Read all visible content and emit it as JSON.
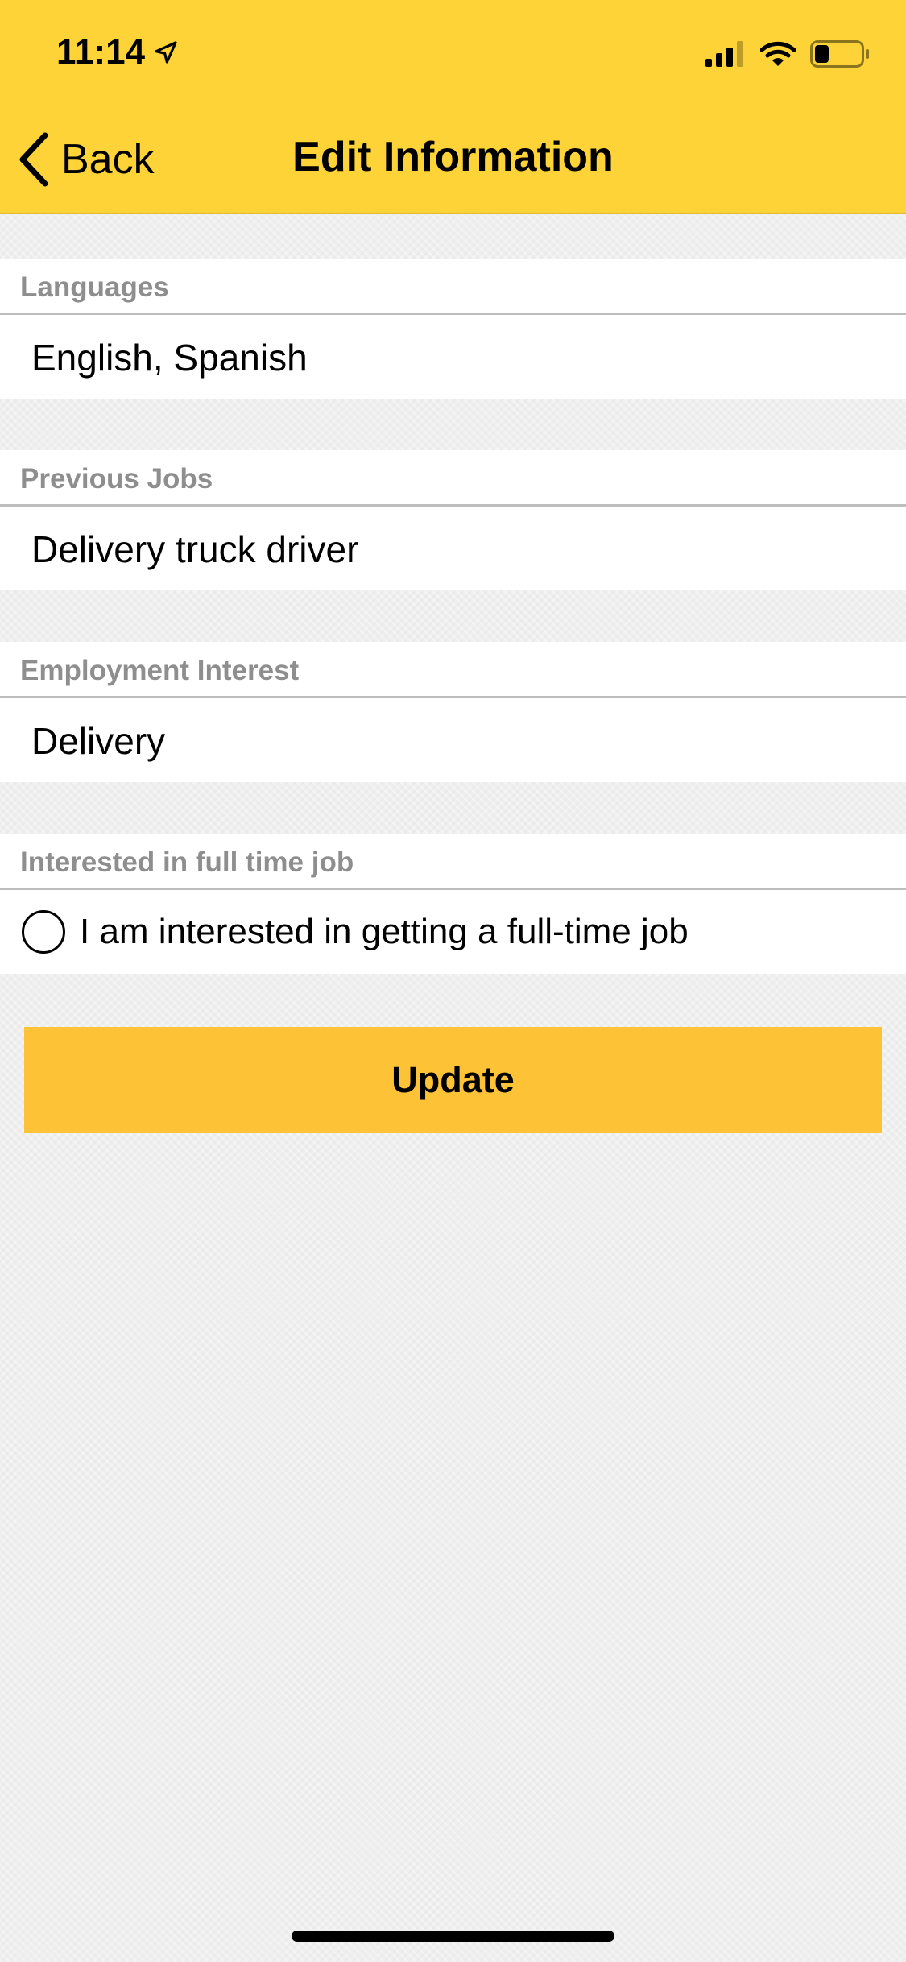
{
  "status_bar": {
    "time": "11:14",
    "location_icon": "location-arrow-icon",
    "signal_icon": "cellular-signal-icon",
    "wifi_icon": "wifi-icon",
    "battery_icon": "battery-icon",
    "battery_level": 0.3
  },
  "nav": {
    "back_label": "Back",
    "back_icon": "chevron-left-icon",
    "title": "Edit Information"
  },
  "sections": {
    "languages": {
      "header": "Languages",
      "value": "English, Spanish"
    },
    "previous_jobs": {
      "header": "Previous Jobs",
      "value": "Delivery truck driver"
    },
    "employment_interest": {
      "header": "Employment Interest",
      "value": "Delivery"
    },
    "full_time": {
      "header": "Interested in full time job",
      "checkbox_label": "I am interested in getting a full-time job",
      "checked": false
    }
  },
  "update_button": {
    "label": "Update"
  },
  "colors": {
    "header_background": "#fdd337",
    "button_background": "#fdc235",
    "section_header_text": "#8e8e8e",
    "page_background": "#efefef"
  }
}
